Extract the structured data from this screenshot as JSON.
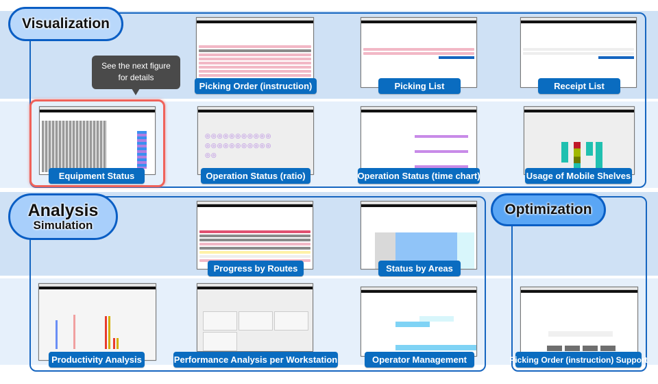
{
  "sections": {
    "visualization": {
      "title": "Visualization"
    },
    "analysis": {
      "title": "Analysis",
      "subtitle": "Simulation"
    },
    "optimization": {
      "title": "Optimization"
    }
  },
  "tooltip": {
    "line1": "See the next figure",
    "line2": "for details"
  },
  "screens": {
    "picking_order": "Picking Order (instruction)",
    "picking_list": "Picking List",
    "receipt_list": "Receipt List",
    "equipment_status": "Equipment Status",
    "operation_ratio": "Operation Status (ratio)",
    "operation_timechart": "Operation Status (time chart)",
    "mobile_shelves": "Usage of Mobile Shelves",
    "progress_routes": "Progress by Routes",
    "status_areas": "Status by Areas",
    "productivity": "Productivity Analysis",
    "performance_workstation": "Performance Analysis per Workstation",
    "operator_management": "Operator Management",
    "picking_support": "Picking Order (instruction) Support"
  },
  "colors": {
    "accent": "#0a6cc0",
    "frame": "#1565c0",
    "highlight": "#f0625a",
    "band_dark": "#cfe1f5",
    "band_light": "#e6f0fb"
  }
}
